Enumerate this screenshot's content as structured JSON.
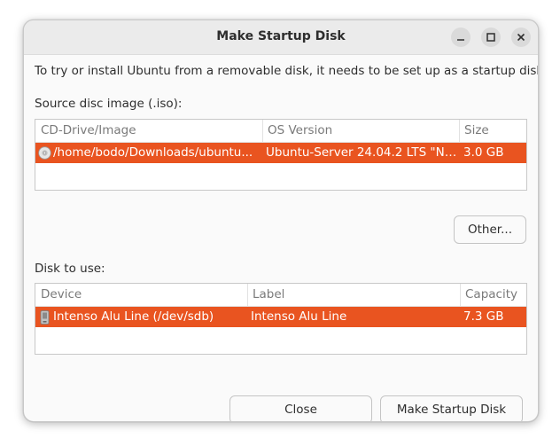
{
  "window": {
    "title": "Make Startup Disk"
  },
  "intro_text": "To try or install Ubuntu from a removable disk, it needs to be set up as a startup disk.",
  "source": {
    "label": "Source disc image (.iso):",
    "columns": [
      "CD-Drive/Image",
      "OS Version",
      "Size"
    ],
    "rows": [
      {
        "icon": "disc-icon",
        "image": "/home/bodo/Downloads/ubuntu...",
        "os_version": "Ubuntu-Server 24.04.2 LTS \"No...",
        "size": "3.0 GB",
        "selected": true
      }
    ],
    "other_button": "Other..."
  },
  "disk": {
    "label": "Disk to use:",
    "columns": [
      "Device",
      "Label",
      "Capacity"
    ],
    "rows": [
      {
        "icon": "usb-drive-icon",
        "device": "Intenso Alu Line (/dev/sdb)",
        "label": "Intenso Alu Line",
        "capacity": "7.3 GB",
        "selected": true
      }
    ]
  },
  "buttons": {
    "close": "Close",
    "make": "Make Startup Disk"
  },
  "colors": {
    "selection": "#e95420",
    "titlebar": "#ebebeb",
    "window_bg": "#fafafa"
  }
}
